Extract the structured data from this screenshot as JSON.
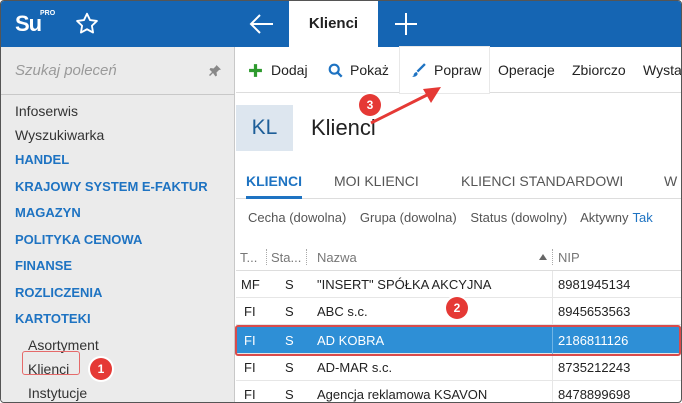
{
  "topbar": {
    "logo_text": "Su",
    "logo_sup": "PRO",
    "active_tab": "Klienci",
    "icons": [
      "star-icon",
      "back-arrow-icon",
      "plus-icon"
    ]
  },
  "sidebar": {
    "search_placeholder": "Szukaj poleceń",
    "items": [
      {
        "label": "Infoserwis",
        "type": "plain"
      },
      {
        "label": "Wyszukiwarka",
        "type": "plain"
      },
      {
        "label": "HANDEL",
        "type": "section"
      },
      {
        "label": "KRAJOWY SYSTEM E-FAKTUR",
        "type": "section"
      },
      {
        "label": "MAGAZYN",
        "type": "section"
      },
      {
        "label": "POLITYKA CENOWA",
        "type": "section"
      },
      {
        "label": "FINANSE",
        "type": "section"
      },
      {
        "label": "ROZLICZENIA",
        "type": "section"
      },
      {
        "label": "KARTOTEKI",
        "type": "section"
      },
      {
        "label": "Asortyment",
        "type": "sub"
      },
      {
        "label": "Klienci",
        "type": "sub"
      },
      {
        "label": "Instytucje",
        "type": "sub"
      }
    ]
  },
  "toolbar": {
    "dodaj": "Dodaj",
    "pokaz": "Pokaż",
    "popraw": "Popraw",
    "operacje": "Operacje",
    "zbiorczo": "Zbiorczo",
    "wysta": "Wysta"
  },
  "header": {
    "badge": "KL",
    "title": "Klienci"
  },
  "tabs": [
    "KLIENCI",
    "MOI KLIENCI",
    "KLIENCI STANDARDOWI",
    "W"
  ],
  "filters": {
    "cecha": "Cecha (dowolna)",
    "grupa": "Grupa (dowolna)",
    "status": "Status (dowolny)",
    "aktywny": "Aktywny",
    "aktywny_value": "Tak"
  },
  "grid": {
    "columns": [
      "T...",
      "Sta...",
      "Nazwa",
      "NIP"
    ],
    "rows": [
      {
        "t": "MF",
        "sta": "S",
        "nazwa": "\"INSERT\" SPÓŁKA AKCYJNA",
        "nip": "8981945134"
      },
      {
        "t": "FI",
        "sta": "S",
        "nazwa": "ABC s.c.",
        "nip": "8945653563"
      },
      {
        "t": "FI",
        "sta": "S",
        "nazwa": "AD KOBRA",
        "nip": "2186811126"
      },
      {
        "t": "FI",
        "sta": "S",
        "nazwa": "AD-MAR s.c.",
        "nip": "8735212243"
      },
      {
        "t": "FI",
        "sta": "S",
        "nazwa": "Agencja reklamowa KSAVON",
        "nip": "8478899698"
      }
    ],
    "selected_row": 2
  },
  "markers": {
    "m1": "1",
    "m2": "2",
    "m3": "3"
  },
  "colors": {
    "accent": "#1565b3",
    "selection": "#2e8fd6",
    "marker": "#e53935"
  }
}
